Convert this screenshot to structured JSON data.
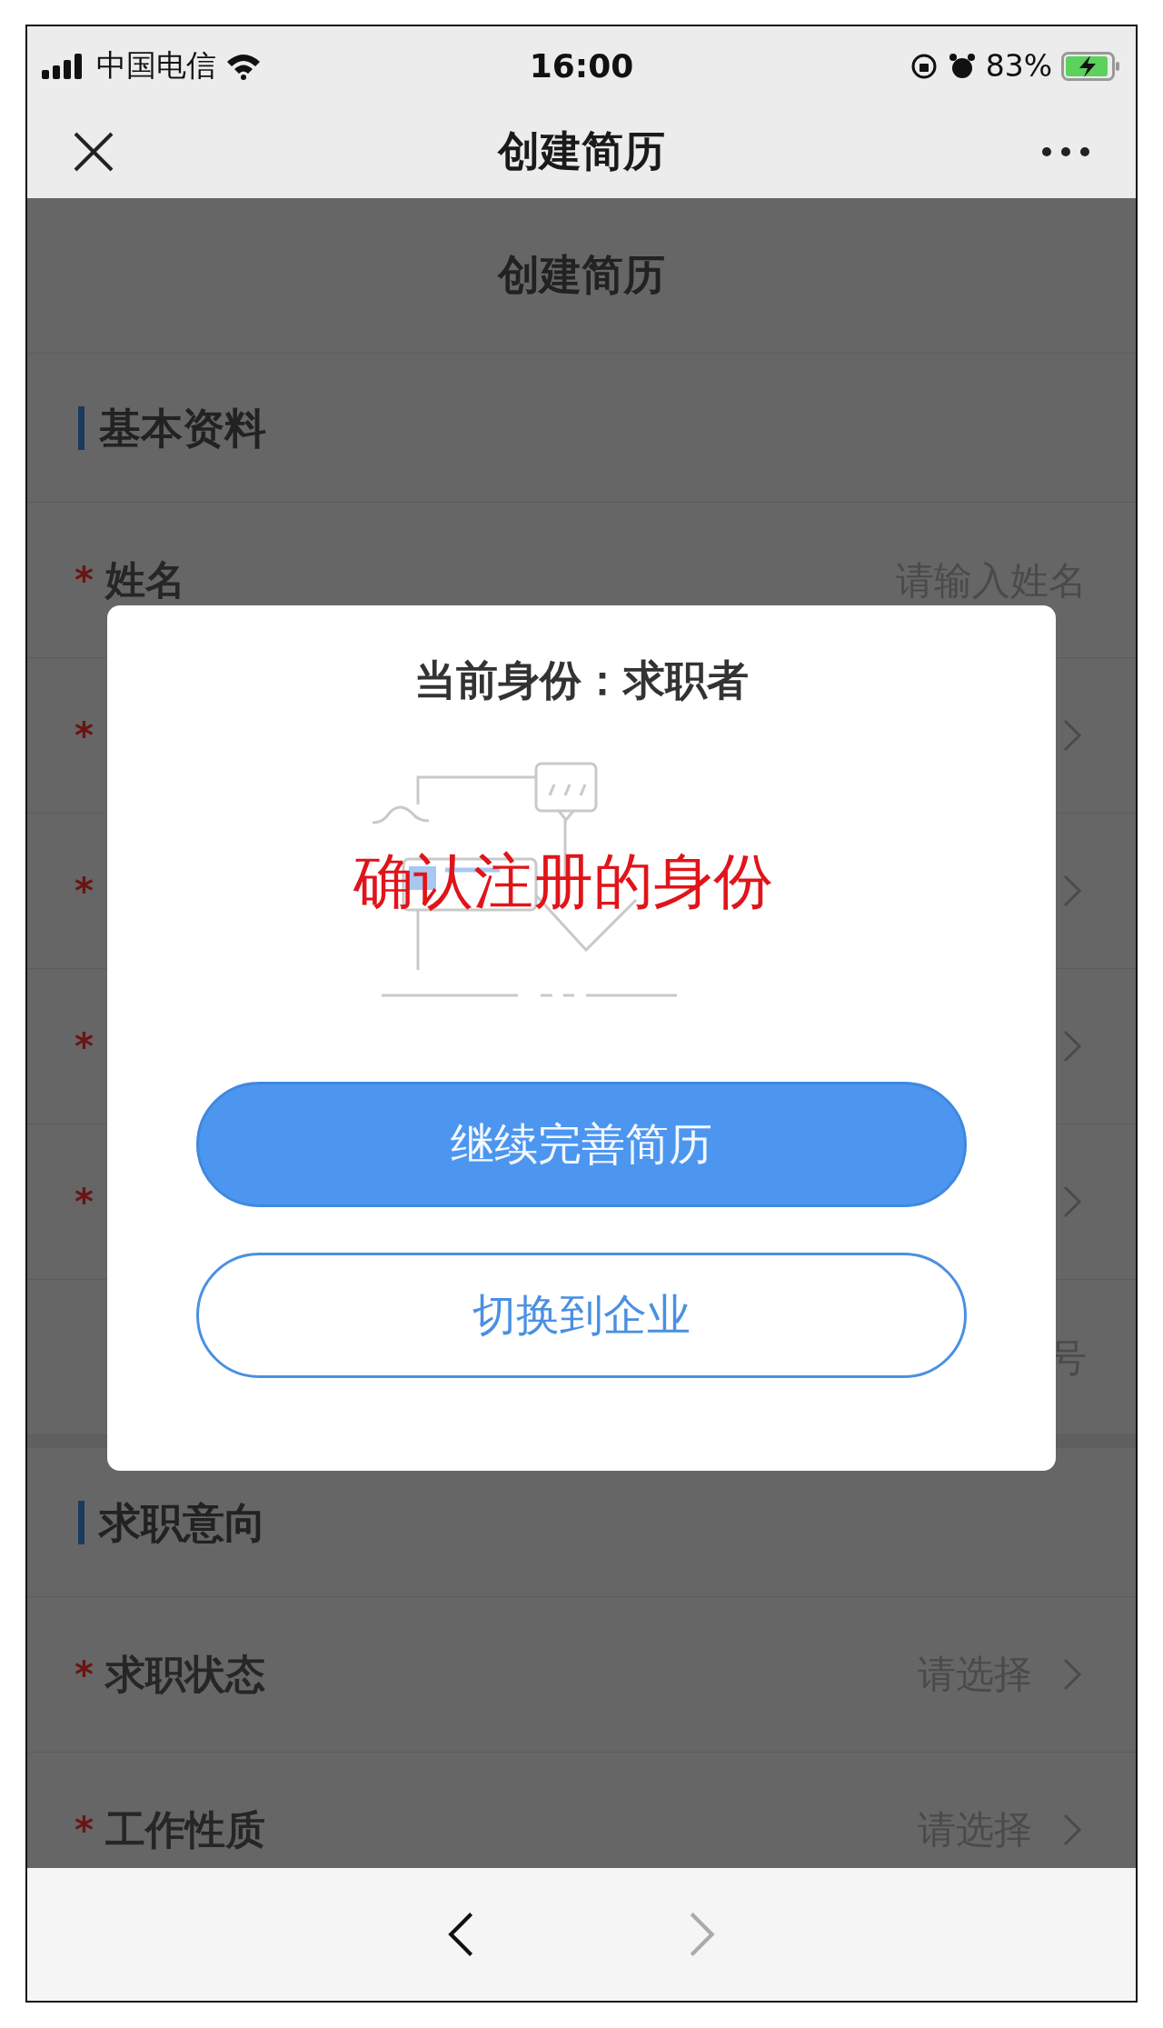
{
  "status_bar": {
    "carrier": "中国电信",
    "time": "16:00",
    "battery": "83%"
  },
  "nav_bar": {
    "title": "创建简历"
  },
  "page": {
    "title": "创建简历",
    "sections": [
      {
        "title": "基本资料",
        "fields": [
          {
            "kind": "input",
            "required_mark": "*",
            "label": "姓名",
            "placeholder": "请输入姓名"
          },
          {
            "kind": "select",
            "required_mark": "*"
          },
          {
            "kind": "select",
            "required_mark": "*"
          },
          {
            "kind": "select",
            "required_mark": "*"
          },
          {
            "kind": "select",
            "required_mark": "*"
          },
          {
            "kind": "input",
            "placeholder": "号"
          }
        ]
      },
      {
        "title": "求职意向",
        "fields": [
          {
            "kind": "select",
            "required_mark": "*",
            "label": "求职状态",
            "placeholder": "请选择"
          },
          {
            "kind": "select",
            "required_mark": "*",
            "label": "工作性质",
            "placeholder": "请选择"
          }
        ]
      }
    ]
  },
  "dialog": {
    "title": "当前身份：求职者",
    "annotation": "确认注册的身份",
    "buttons": [
      {
        "kind": "primary",
        "label": "继续完善简历"
      },
      {
        "kind": "outline",
        "label": "切换到企业"
      }
    ]
  },
  "toolbar": {
    "buttons": [
      {
        "kind": "back",
        "disabled": false
      },
      {
        "kind": "forward",
        "disabled": true
      }
    ]
  }
}
